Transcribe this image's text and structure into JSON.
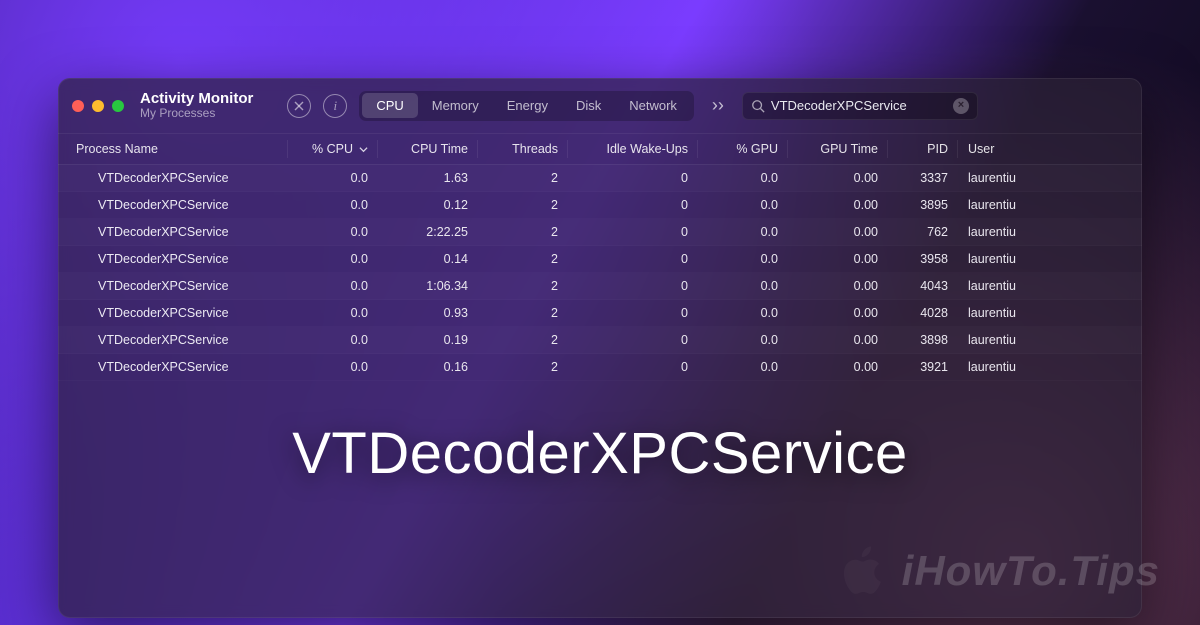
{
  "window": {
    "title": "Activity Monitor",
    "subtitle": "My Processes"
  },
  "tabs": [
    {
      "label": "CPU",
      "active": true
    },
    {
      "label": "Memory",
      "active": false
    },
    {
      "label": "Energy",
      "active": false
    },
    {
      "label": "Disk",
      "active": false
    },
    {
      "label": "Network",
      "active": false
    }
  ],
  "search": {
    "value": "VTDecoderXPCService"
  },
  "columns": [
    {
      "label": "Process Name",
      "sorted": false
    },
    {
      "label": "% CPU",
      "sorted": true
    },
    {
      "label": "CPU Time",
      "sorted": false
    },
    {
      "label": "Threads",
      "sorted": false
    },
    {
      "label": "Idle Wake-Ups",
      "sorted": false
    },
    {
      "label": "% GPU",
      "sorted": false
    },
    {
      "label": "GPU Time",
      "sorted": false
    },
    {
      "label": "PID",
      "sorted": false
    },
    {
      "label": "User",
      "sorted": false
    }
  ],
  "rows": [
    {
      "name": "VTDecoderXPCService",
      "cpu": "0.0",
      "cputime": "1.63",
      "threads": "2",
      "idle": "0",
      "gpu": "0.0",
      "gputime": "0.00",
      "pid": "3337",
      "user": "laurentiu"
    },
    {
      "name": "VTDecoderXPCService",
      "cpu": "0.0",
      "cputime": "0.12",
      "threads": "2",
      "idle": "0",
      "gpu": "0.0",
      "gputime": "0.00",
      "pid": "3895",
      "user": "laurentiu"
    },
    {
      "name": "VTDecoderXPCService",
      "cpu": "0.0",
      "cputime": "2:22.25",
      "threads": "2",
      "idle": "0",
      "gpu": "0.0",
      "gputime": "0.00",
      "pid": "762",
      "user": "laurentiu"
    },
    {
      "name": "VTDecoderXPCService",
      "cpu": "0.0",
      "cputime": "0.14",
      "threads": "2",
      "idle": "0",
      "gpu": "0.0",
      "gputime": "0.00",
      "pid": "3958",
      "user": "laurentiu"
    },
    {
      "name": "VTDecoderXPCService",
      "cpu": "0.0",
      "cputime": "1:06.34",
      "threads": "2",
      "idle": "0",
      "gpu": "0.0",
      "gputime": "0.00",
      "pid": "4043",
      "user": "laurentiu"
    },
    {
      "name": "VTDecoderXPCService",
      "cpu": "0.0",
      "cputime": "0.93",
      "threads": "2",
      "idle": "0",
      "gpu": "0.0",
      "gputime": "0.00",
      "pid": "4028",
      "user": "laurentiu"
    },
    {
      "name": "VTDecoderXPCService",
      "cpu": "0.0",
      "cputime": "0.19",
      "threads": "2",
      "idle": "0",
      "gpu": "0.0",
      "gputime": "0.00",
      "pid": "3898",
      "user": "laurentiu"
    },
    {
      "name": "VTDecoderXPCService",
      "cpu": "0.0",
      "cputime": "0.16",
      "threads": "2",
      "idle": "0",
      "gpu": "0.0",
      "gputime": "0.00",
      "pid": "3921",
      "user": "laurentiu"
    }
  ],
  "overlay": {
    "headline": "VTDecoderXPCService"
  },
  "watermark": {
    "text": "iHowTo.Tips"
  }
}
